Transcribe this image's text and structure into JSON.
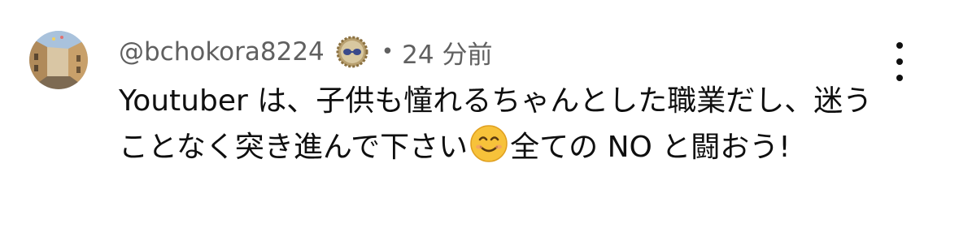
{
  "comment": {
    "author_handle": "@bchokora8224",
    "badge_icon": "member-badge-icon",
    "separator": "•",
    "timestamp": "24 分前",
    "text_part1": "Youtuber は、子供も憧れるちゃんとした職業だし、迷うことなく突き進んで下さい",
    "emoji_icon": "smiling-face-emoji",
    "text_part2": "全ての NO と闘おう!",
    "more_icon": "more-vert-icon"
  },
  "colors": {
    "meta_text": "#606060",
    "body_text": "#0f0f0f",
    "background": "#ffffff"
  }
}
